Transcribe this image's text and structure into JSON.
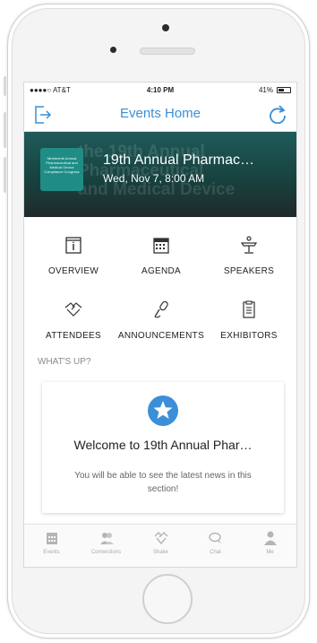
{
  "status_bar": {
    "carrier": "●●●●○ AT&T",
    "time": "4:10 PM",
    "battery": "41%"
  },
  "nav": {
    "title": "Events Home"
  },
  "banner": {
    "event_title": "19th Annual Pharmac…",
    "event_date": "Wed, Nov 7, 8:00 AM",
    "background_text": [
      "the 19th Annual",
      "Pharmaceutical",
      "and Medical Device"
    ],
    "logo_text": "Nineteenth Annual Pharmaceutical and Medical Device Compliance Congress"
  },
  "menu": [
    {
      "label": "OVERVIEW",
      "icon": "overview-icon"
    },
    {
      "label": "AGENDA",
      "icon": "calendar-icon"
    },
    {
      "label": "SPEAKERS",
      "icon": "podium-icon"
    },
    {
      "label": "ATTENDEES",
      "icon": "handshake-icon"
    },
    {
      "label": "ANNOUNCEMENTS",
      "icon": "microphone-icon"
    },
    {
      "label": "EXHIBITORS",
      "icon": "clipboard-icon"
    }
  ],
  "whats_up": {
    "label": "WHAT'S UP?",
    "card_title": "Welcome to 19th Annual Phar…",
    "card_body": "You will be able to see the latest news in this section!"
  },
  "tabbar": [
    {
      "label": "Events",
      "icon": "events-icon"
    },
    {
      "label": "Connections",
      "icon": "connections-icon"
    },
    {
      "label": "Shake",
      "icon": "shake-icon"
    },
    {
      "label": "Chat",
      "icon": "chat-icon"
    },
    {
      "label": "Me",
      "icon": "person-icon"
    }
  ],
  "colors": {
    "accent": "#3a8fd8",
    "banner": "#1f5b5a",
    "star": "#3a8fd8"
  }
}
